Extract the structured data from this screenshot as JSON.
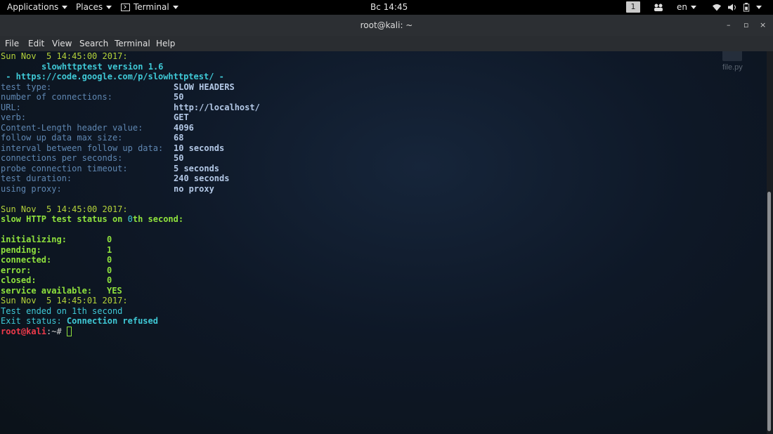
{
  "topbar": {
    "applications": "Applications",
    "places": "Places",
    "terminal": "Terminal",
    "clock": "Вс 14:45",
    "workspace": "1",
    "language": "en"
  },
  "window": {
    "title": "root@kali: ~",
    "minimize": "–",
    "maximize": "▫",
    "close": "×"
  },
  "menubar": [
    "File",
    "Edit",
    "View",
    "Search",
    "Terminal",
    "Help"
  ],
  "desktop": {
    "file_label": "file.py"
  },
  "terminal": {
    "header_date": "Sun Nov  5 14:45:00 2017:",
    "version": "slowhttptest version 1.6",
    "url_line": " - https://code.google.com/p/slowhttptest/ -",
    "params": [
      {
        "label": "test type:",
        "value": "SLOW HEADERS"
      },
      {
        "label": "number of connections:",
        "value": "50"
      },
      {
        "label": "URL:",
        "value": "http://localhost/"
      },
      {
        "label": "verb:",
        "value": "GET"
      },
      {
        "label": "Content-Length header value:",
        "value": "4096"
      },
      {
        "label": "follow up data max size:",
        "value": "68"
      },
      {
        "label": "interval between follow up data:",
        "value": "10 seconds"
      },
      {
        "label": "connections per seconds:",
        "value": "50"
      },
      {
        "label": "probe connection timeout:",
        "value": "5 seconds"
      },
      {
        "label": "test duration:",
        "value": "240 seconds"
      },
      {
        "label": "using proxy:",
        "value": "no proxy"
      }
    ],
    "status_date": "Sun Nov  5 14:45:00 2017:",
    "status_pre": "slow HTTP test status on ",
    "status_num": "0",
    "status_post": "th second:",
    "stats": [
      {
        "label": "initializing:",
        "value": "0"
      },
      {
        "label": "pending:",
        "value": "1"
      },
      {
        "label": "connected:",
        "value": "0"
      },
      {
        "label": "error:",
        "value": "0"
      },
      {
        "label": "closed:",
        "value": "0"
      },
      {
        "label": "service available:",
        "value": "YES"
      }
    ],
    "end_date": "Sun Nov  5 14:45:01 2017:",
    "ended": "Test ended on 1th second",
    "exit_label": "Exit status: ",
    "exit_value": "Connection refused",
    "prompt_user": "root@kali",
    "prompt_rest": ":~#"
  },
  "colors": {
    "terminal_bg": "#0b1219",
    "yellow": "#b5d33a",
    "cyan": "#3fc9d6",
    "green": "#8fe23d",
    "red": "#ee3a4a"
  }
}
